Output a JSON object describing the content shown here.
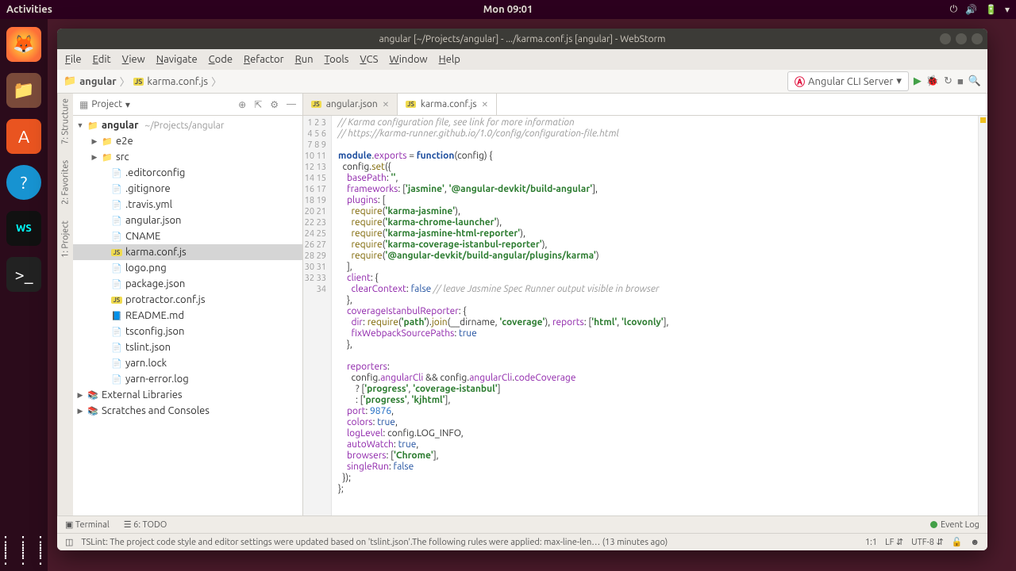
{
  "os": {
    "activities": "Activities",
    "clock": "Mon 09:01"
  },
  "window": {
    "title": "angular [~/Projects/angular] - .../karma.conf.js [angular] - WebStorm"
  },
  "menus": [
    "File",
    "Edit",
    "View",
    "Navigate",
    "Code",
    "Refactor",
    "Run",
    "Tools",
    "VCS",
    "Window",
    "Help"
  ],
  "breadcrumb": {
    "root": "angular",
    "file": "karma.conf.js"
  },
  "run_config": {
    "label": "Angular CLI Server"
  },
  "project_tool": {
    "title": "Project"
  },
  "left_tools": [
    "1: Project",
    "2: Favorites",
    "7: Structure"
  ],
  "tree": {
    "root": {
      "name": "angular",
      "hint": "~/Projects/angular"
    },
    "dirs": [
      "e2e",
      "src"
    ],
    "files": [
      {
        "n": ".editorconfig",
        "c": "json"
      },
      {
        "n": ".gitignore",
        "c": "json"
      },
      {
        "n": ".travis.yml",
        "c": "json"
      },
      {
        "n": "angular.json",
        "c": "json"
      },
      {
        "n": "CNAME",
        "c": "json"
      },
      {
        "n": "karma.conf.js",
        "c": "js",
        "sel": true
      },
      {
        "n": "logo.png",
        "c": "json"
      },
      {
        "n": "package.json",
        "c": "json"
      },
      {
        "n": "protractor.conf.js",
        "c": "js"
      },
      {
        "n": "README.md",
        "c": "md"
      },
      {
        "n": "tsconfig.json",
        "c": "json"
      },
      {
        "n": "tslint.json",
        "c": "json"
      },
      {
        "n": "yarn.lock",
        "c": "json"
      },
      {
        "n": "yarn-error.log",
        "c": "json"
      }
    ],
    "extras": [
      "External Libraries",
      "Scratches and Consoles"
    ]
  },
  "tabs": [
    {
      "label": "angular.json",
      "active": false
    },
    {
      "label": "karma.conf.js",
      "active": true
    }
  ],
  "code_lines": [
    "<span class='c-cm'>// Karma configuration file, see link for more information</span>",
    "<span class='c-cm'>// https://karma-runner.github.io/1.0/config/configuration-file.html</span>",
    "",
    "<span class='c-kw'>module</span>.<span class='c-id'>exports</span> = <span class='c-kw'>function</span>(config) {",
    "  config.<span class='c-fn'>set</span>({",
    "    <span class='c-id'>basePath</span>: <span class='c-st'>''</span>,",
    "    <span class='c-id'>frameworks</span>: [<span class='c-st'>'jasmine'</span>, <span class='c-st'>'@angular-devkit/build-angular'</span>],",
    "    <span class='c-id'>plugins</span>: [",
    "      <span class='c-fn'>require</span>(<span class='c-st'>'karma-jasmine'</span>),",
    "      <span class='c-fn'>require</span>(<span class='c-st'>'karma-chrome-launcher'</span>),",
    "      <span class='c-fn'>require</span>(<span class='c-st'>'karma-jasmine-html-reporter'</span>),",
    "      <span class='c-fn'>require</span>(<span class='c-st'>'karma-coverage-istanbul-reporter'</span>),",
    "      <span class='c-fn'>require</span>(<span class='c-st'>'@angular-devkit/build-angular/plugins/karma'</span>)",
    "    ],",
    "    <span class='c-id'>client</span>: {",
    "      <span class='c-id'>clearContext</span>: <span class='c-bl'>false</span> <span class='c-cm'>// leave Jasmine Spec Runner output visible in browser</span>",
    "    },",
    "    <span class='c-id'>coverageIstanbulReporter</span>: {",
    "      <span class='c-id'>dir</span>: <span class='c-fn'>require</span>(<span class='c-st'>'path'</span>).<span class='c-fn'>join</span>(__dirname, <span class='c-st'>'coverage'</span>), <span class='c-id'>reports</span>: [<span class='c-st'>'html'</span>, <span class='c-st'>'lcovonly'</span>],",
    "      <span class='c-id'>fixWebpackSourcePaths</span>: <span class='c-bl'>true</span>",
    "    },",
    "",
    "    <span class='c-id'>reporters</span>:",
    "      config.<span class='c-id'>angularCli</span> && config.<span class='c-id'>angularCli</span>.<span class='c-id'>codeCoverage</span>",
    "        ? [<span class='c-st'>'progress'</span>, <span class='c-st'>'coverage-istanbul'</span>]",
    "        : [<span class='c-st'>'progress'</span>, <span class='c-st'>'kjhtml'</span>],",
    "    <span class='c-id'>port</span>: <span class='c-nm'>9876</span>,",
    "    <span class='c-id'>colors</span>: <span class='c-bl'>true</span>,",
    "    <span class='c-id'>logLevel</span>: config.LOG_INFO,",
    "    <span class='c-id'>autoWatch</span>: <span class='c-bl'>true</span>,",
    "    <span class='c-id'>browsers</span>: [<span class='c-st'>'Chrome'</span>],",
    "    <span class='c-id'>singleRun</span>: <span class='c-bl'>false</span>",
    "  });",
    "};"
  ],
  "bottom_tools": {
    "terminal": "Terminal",
    "todo": "6: TODO",
    "event_log": "Event Log"
  },
  "status": {
    "msg": "TSLint: The project code style and editor settings were updated based on 'tslint.json'.The following rules were applied: max-line-len… (13 minutes ago)",
    "pos": "1:1",
    "eol": "LF",
    "enc": "UTF-8"
  }
}
